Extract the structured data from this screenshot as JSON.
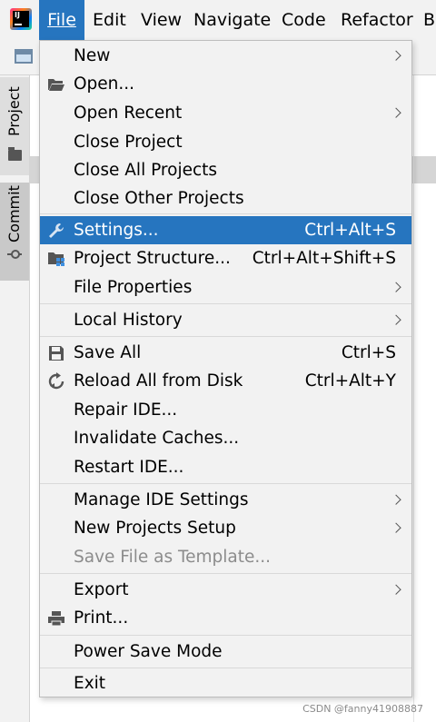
{
  "menubar": {
    "items": [
      "File",
      "Edit",
      "View",
      "Navigate",
      "Code",
      "Refactor",
      "Bu"
    ],
    "app_logo_text": "IJ"
  },
  "sidebar": {
    "project_label": "Project",
    "commit_label": "Commit"
  },
  "file_menu": {
    "new": "New",
    "open": "Open...",
    "open_recent": "Open Recent",
    "close_project": "Close Project",
    "close_all_projects": "Close All Projects",
    "close_other_projects": "Close Other Projects",
    "settings": "Settings...",
    "settings_shortcut": "Ctrl+Alt+S",
    "project_structure": "Project Structure...",
    "project_structure_shortcut": "Ctrl+Alt+Shift+S",
    "file_properties": "File Properties",
    "local_history": "Local History",
    "save_all": "Save All",
    "save_all_shortcut": "Ctrl+S",
    "reload_all": "Reload All from Disk",
    "reload_all_shortcut": "Ctrl+Alt+Y",
    "repair_ide": "Repair IDE...",
    "invalidate_caches": "Invalidate Caches...",
    "restart_ide": "Restart IDE...",
    "manage_ide_settings": "Manage IDE Settings",
    "new_projects_setup": "New Projects Setup",
    "save_file_as_template": "Save File as Template...",
    "export": "Export",
    "print": "Print...",
    "power_save_mode": "Power Save Mode",
    "exit": "Exit"
  },
  "watermark": "CSDN @fanny41908887",
  "colors": {
    "selection": "#2675bf",
    "menu_background": "#f2f2f2",
    "disabled_text": "#8c8c8c"
  }
}
